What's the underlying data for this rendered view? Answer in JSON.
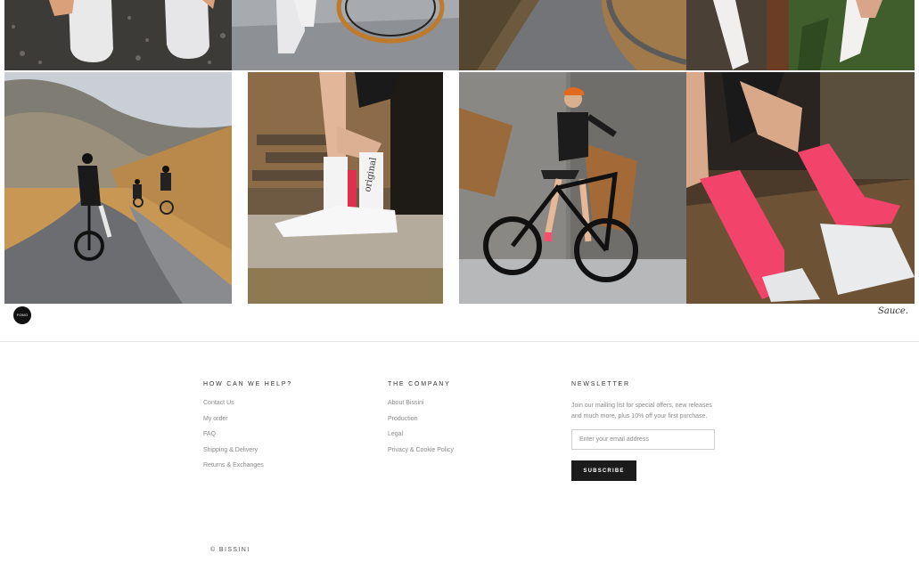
{
  "gallery": {
    "badge_text": "FOMO",
    "sauce_logo": "Sauce."
  },
  "footer": {
    "help": {
      "title": "HOW CAN WE HELP?",
      "links": [
        "Contact Us",
        "My order",
        "FAQ",
        "Shipping & Delivery",
        "Returns & Exchanges"
      ]
    },
    "company": {
      "title": "THE COMPANY",
      "links": [
        "About Bissini",
        "Production",
        "Legal",
        "Privacy & Cookie Policy"
      ]
    },
    "newsletter": {
      "title": "NEWSLETTER",
      "text": "Join our mailing list for special offers, new releases and much more, plus 10% off your first purchase.",
      "email_placeholder": "Enter your email address",
      "subscribe_label": "SUBSCRIBE"
    },
    "copyright": "© BISSINI"
  },
  "colors": {
    "accent": "#1b1b1b",
    "pink_sock": "#f2436b"
  }
}
